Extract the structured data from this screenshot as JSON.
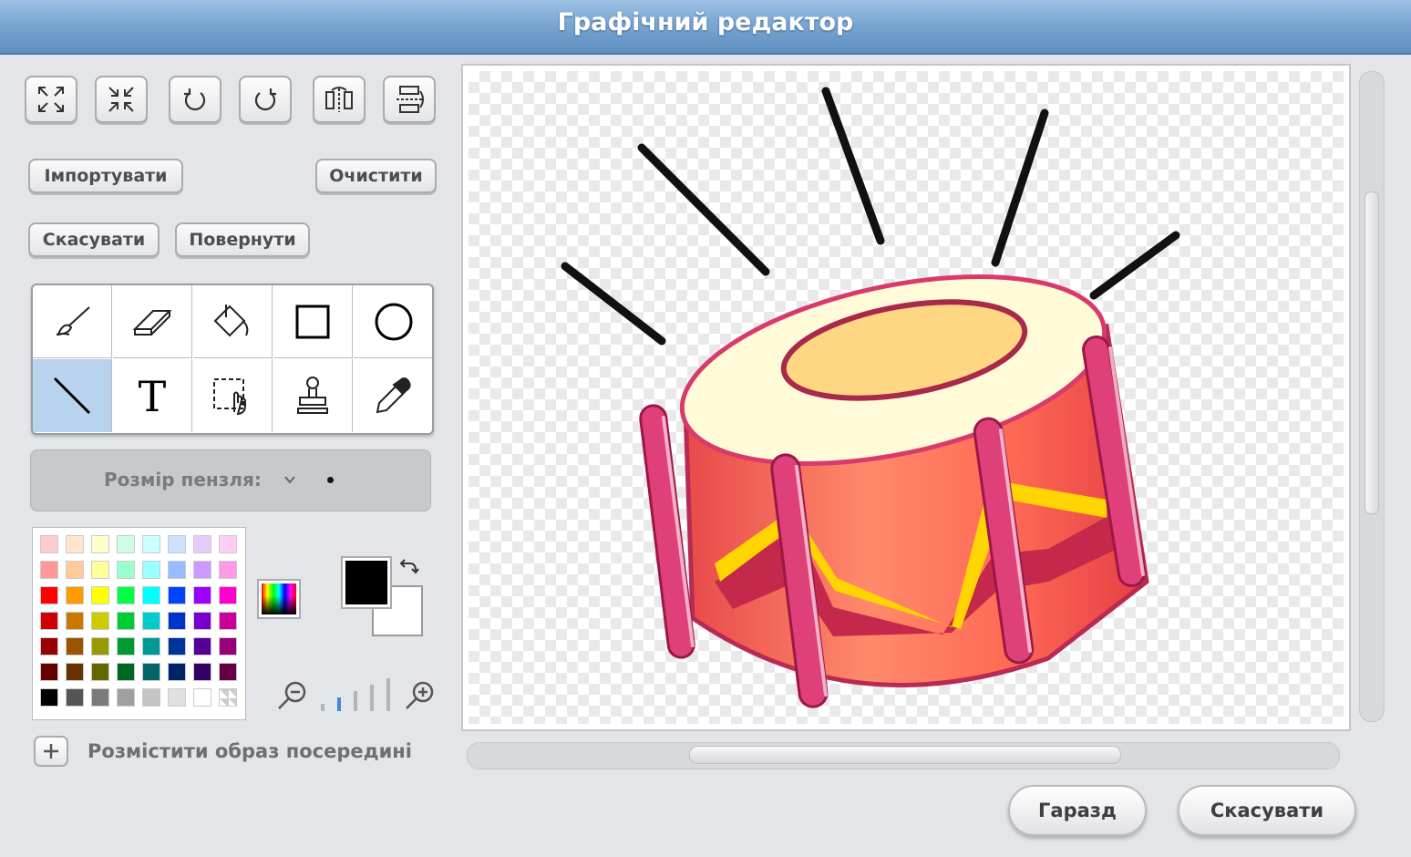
{
  "window": {
    "title": "Графічний редактор"
  },
  "buttons": {
    "import": "Імпортувати",
    "clear": "Очистити",
    "undo": "Скасувати",
    "redo": "Повернути",
    "ok": "Гаразд",
    "cancel": "Скасувати"
  },
  "transform_tools": [
    "grow-icon",
    "shrink-icon",
    "rotate-left-icon",
    "rotate-right-icon",
    "flip-horizontal-icon",
    "flip-vertical-icon"
  ],
  "tools": [
    "paintbrush",
    "eraser",
    "fill",
    "rectangle",
    "ellipse",
    "line",
    "text",
    "select",
    "stamp",
    "eyedropper"
  ],
  "selected_tool": "line",
  "brush": {
    "label": "Розмір пензля:"
  },
  "colors": {
    "foreground": "#000000",
    "background": "#ffffff",
    "accent": "#7aa6d2"
  },
  "palette": [
    [
      "#ffcccc",
      "#ffe5cc",
      "#ffffcc",
      "#ccffe5",
      "#ccffff",
      "#cce0ff",
      "#e5ccff",
      "#ffccf2"
    ],
    [
      "#ff9999",
      "#ffcc99",
      "#ffff99",
      "#99ffcc",
      "#99ffff",
      "#99bbff",
      "#cc99ff",
      "#ff99e5"
    ],
    [
      "#ff0000",
      "#ff9900",
      "#ffff00",
      "#00ff44",
      "#00ffff",
      "#0044ff",
      "#9900ff",
      "#ff00cc"
    ],
    [
      "#cc0000",
      "#cc7700",
      "#cccc00",
      "#00cc33",
      "#00cccc",
      "#0033cc",
      "#7700cc",
      "#cc0099"
    ],
    [
      "#990000",
      "#995500",
      "#999900",
      "#009933",
      "#009999",
      "#003399",
      "#550099",
      "#990077"
    ],
    [
      "#660000",
      "#663300",
      "#666600",
      "#006622",
      "#006666",
      "#002266",
      "#330066",
      "#660044"
    ],
    [
      "#000000",
      "#555555",
      "#7a7a7a",
      "#a0a0a0",
      "#c4c4c4",
      "#e0e0e0",
      "#ffffff",
      "transparent"
    ]
  ],
  "zoom": {
    "level": 2,
    "levels": 5
  },
  "center_option": {
    "label": "Розмістити образ посередині"
  }
}
